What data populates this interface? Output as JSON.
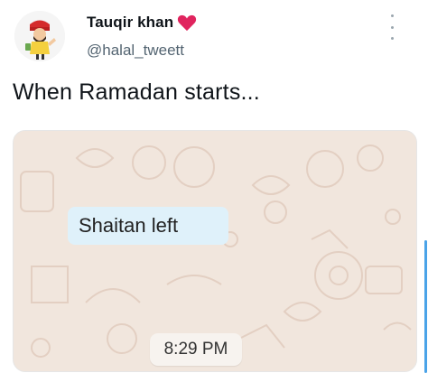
{
  "author": {
    "display_name": "Tauqir khan",
    "handle": "@halal_tweett",
    "badge_icon": "heart-icon",
    "badge_color": "#e0245e"
  },
  "tweet": {
    "text": "When Ramadan starts..."
  },
  "media": {
    "message_text": "Shaitan left",
    "timestamp": "8:29 PM",
    "bubble_color": "#dff1fa",
    "wallpaper_color": "#f1e6dd"
  },
  "menu": {
    "icon": "more-vertical-icon"
  },
  "colors": {
    "accent": "#4aa3e8",
    "secondary_text": "#536471"
  }
}
